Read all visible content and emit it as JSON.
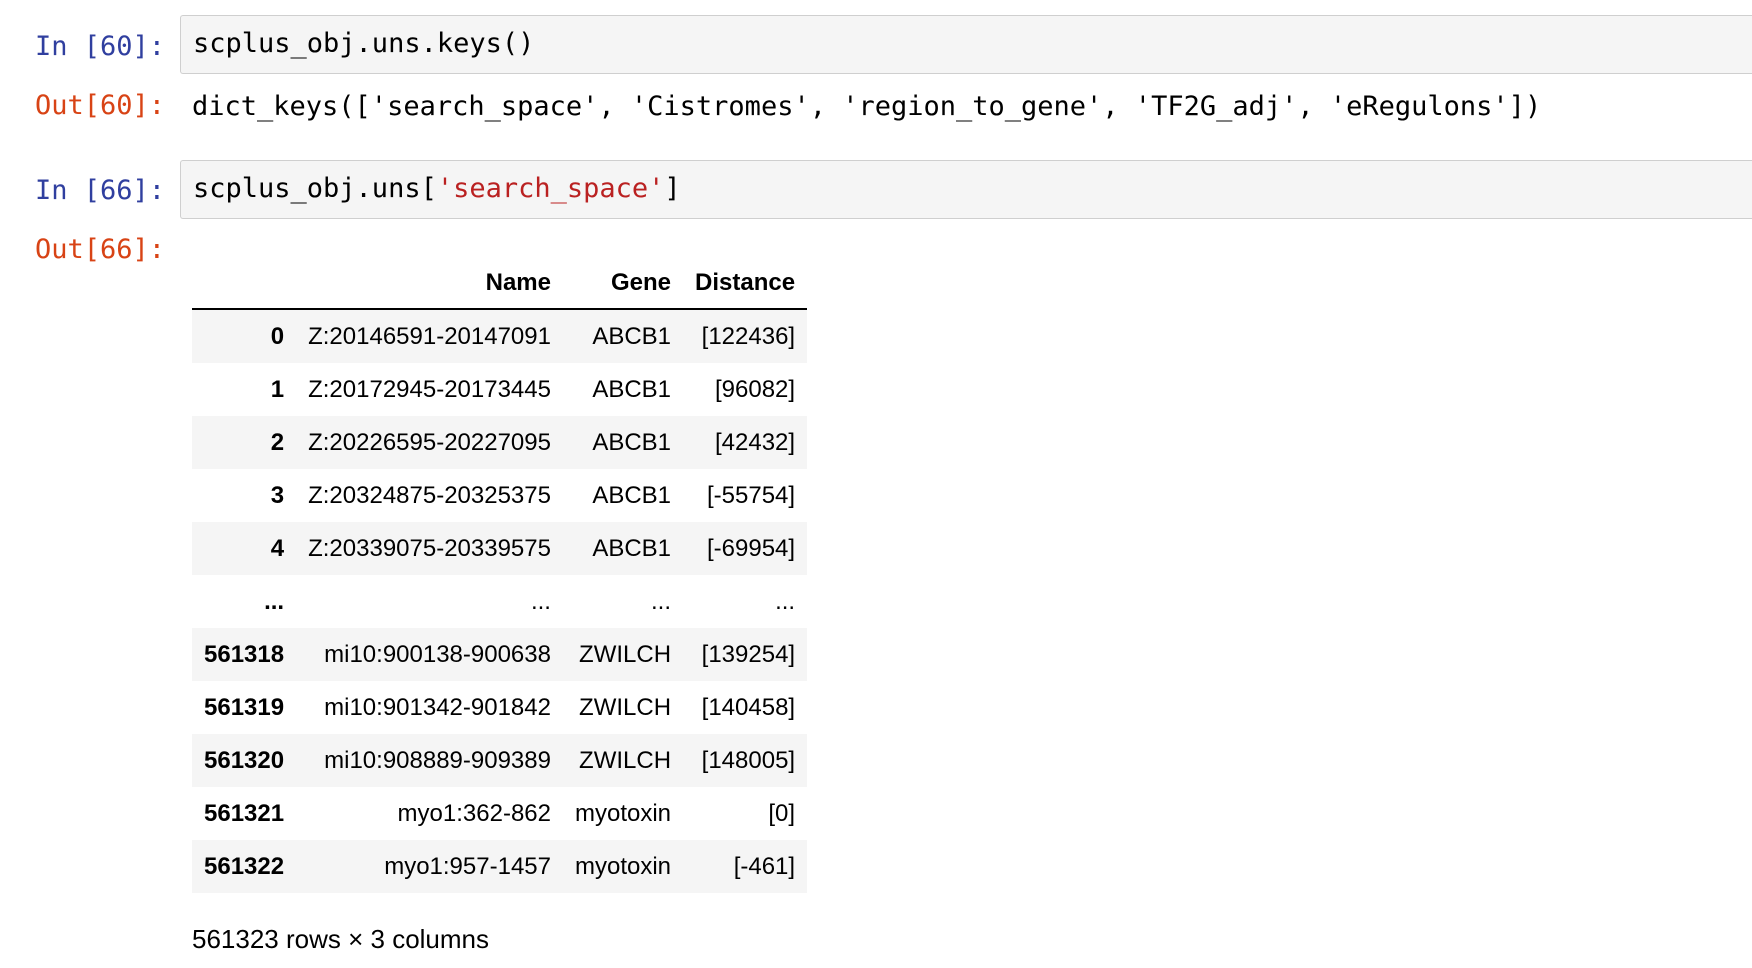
{
  "cells": [
    {
      "in_prompt": "In [60]:",
      "code": "scplus_obj.uns.keys()",
      "out_prompt": "Out[60]:",
      "output_text": "dict_keys(['search_space', 'Cistromes', 'region_to_gene', 'TF2G_adj', 'eRegulons'])"
    },
    {
      "in_prompt": "In [66]:",
      "code_prefix": "scplus_obj.uns[",
      "code_string": "'search_space'",
      "code_suffix": "]",
      "out_prompt": "Out[66]:"
    }
  ],
  "dataframe": {
    "columns": [
      "Name",
      "Gene",
      "Distance"
    ],
    "rows": [
      {
        "index": "0",
        "name": "Z:20146591-20147091",
        "gene": "ABCB1",
        "distance": "[122436]"
      },
      {
        "index": "1",
        "name": "Z:20172945-20173445",
        "gene": "ABCB1",
        "distance": "[96082]"
      },
      {
        "index": "2",
        "name": "Z:20226595-20227095",
        "gene": "ABCB1",
        "distance": "[42432]"
      },
      {
        "index": "3",
        "name": "Z:20324875-20325375",
        "gene": "ABCB1",
        "distance": "[-55754]"
      },
      {
        "index": "4",
        "name": "Z:20339075-20339575",
        "gene": "ABCB1",
        "distance": "[-69954]"
      },
      {
        "index": "...",
        "name": "...",
        "gene": "...",
        "distance": "..."
      },
      {
        "index": "561318",
        "name": "mi10:900138-900638",
        "gene": "ZWILCH",
        "distance": "[139254]"
      },
      {
        "index": "561319",
        "name": "mi10:901342-901842",
        "gene": "ZWILCH",
        "distance": "[140458]"
      },
      {
        "index": "561320",
        "name": "mi10:908889-909389",
        "gene": "ZWILCH",
        "distance": "[148005]"
      },
      {
        "index": "561321",
        "name": "myo1:362-862",
        "gene": "myotoxin",
        "distance": "[0]"
      },
      {
        "index": "561322",
        "name": "myo1:957-1457",
        "gene": "myotoxin",
        "distance": "[-461]"
      }
    ],
    "summary": "561323 rows × 3 columns"
  }
}
